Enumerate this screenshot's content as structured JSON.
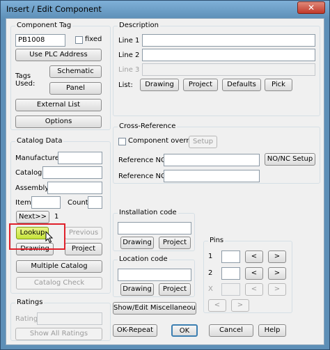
{
  "window": {
    "title": "Insert / Edit Component",
    "close_label": "✕"
  },
  "component_tag": {
    "group_title": "Component Tag",
    "tag_value": "PB1008",
    "fixed_label": "fixed",
    "use_plc_label": "Use PLC Address",
    "tags_used_label": "Tags\nUsed:",
    "schematic_label": "Schematic",
    "panel_label": "Panel",
    "external_list_label": "External List",
    "options_label": "Options"
  },
  "description": {
    "group_title": "Description",
    "line1_label": "Line 1",
    "line2_label": "Line 2",
    "line3_label": "Line 3",
    "list_label": "List:",
    "drawing_label": "Drawing",
    "project_label": "Project",
    "defaults_label": "Defaults",
    "pick_label": "Pick"
  },
  "catalog_data": {
    "group_title": "Catalog Data",
    "manufacturer_label": "Manufacturer",
    "catalog_label": "Catalog",
    "assembly_label": "Assembly",
    "item_label": "Item",
    "count_label": "Count",
    "next_label": "Next>>",
    "page_number": "1",
    "lookup_label": "Lookup",
    "previous_label": "Previous",
    "drawing_label": "Drawing",
    "project_label": "Project",
    "multiple_catalog_label": "Multiple Catalog",
    "catalog_check_label": "Catalog Check"
  },
  "cross_reference": {
    "group_title": "Cross-Reference",
    "component_override_label": "Component override",
    "setup_label": "Setup",
    "reference_no_label": "Reference NO",
    "reference_nc_label": "Reference NC",
    "no_nc_setup_label": "NO/NC Setup"
  },
  "installation_code": {
    "group_title": "Installation code",
    "drawing_label": "Drawing",
    "project_label": "Project"
  },
  "location_code": {
    "group_title": "Location code",
    "drawing_label": "Drawing",
    "project_label": "Project"
  },
  "pins": {
    "group_title": "Pins",
    "pin1_label": "1",
    "pin2_label": "2",
    "pinx_label": "X",
    "prev_label": "<",
    "next_label": ">"
  },
  "ratings": {
    "group_title": "Ratings",
    "rating_label": "Rating",
    "show_all_label": "Show All Ratings"
  },
  "footer": {
    "show_edit_misc_label": "Show/Edit Miscellaneous",
    "ok_repeat_label": "OK-Repeat",
    "ok_label": "OK",
    "cancel_label": "Cancel",
    "help_label": "Help"
  },
  "colors": {
    "title_bar": "#5d8fb7",
    "dialog_bg": "#f0f0f0",
    "lookup_highlight": "#c6e43a",
    "callout_border": "#e0202a",
    "close_button": "#c0392b"
  }
}
